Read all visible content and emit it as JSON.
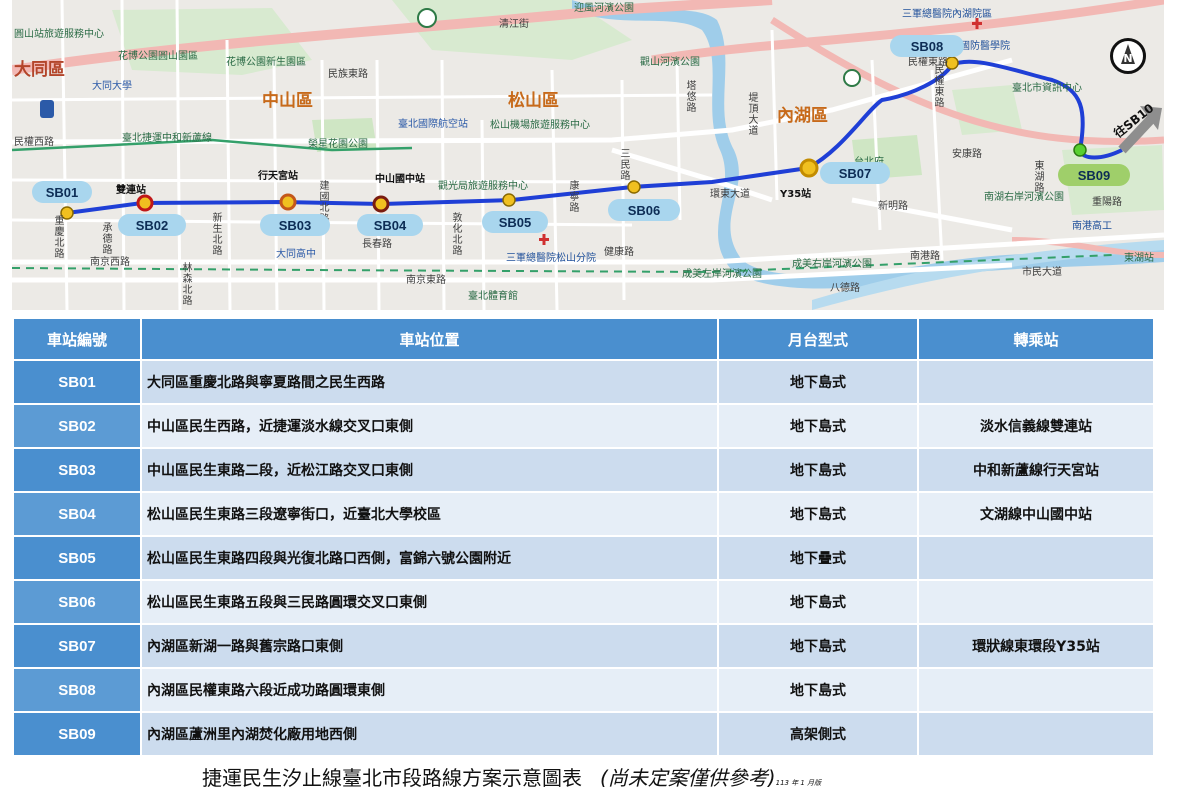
{
  "map": {
    "districts": [
      "大同區",
      "中山區",
      "松山區",
      "內湖區"
    ],
    "roads": [
      "民權東路",
      "民族東路",
      "民權西路",
      "南京西路",
      "南京東路",
      "新明路",
      "南港路",
      "市民大道",
      "安康路",
      "重慶北路",
      "承德路",
      "林森北路",
      "新生北路",
      "建國北路",
      "敦化北路",
      "塔悠路",
      "三民路",
      "環東大道",
      "長春路",
      "東湖路",
      "重陽路",
      "康寧路",
      "健康路",
      "清江街",
      "堤頂大道",
      "成美左岸河濱公園",
      "成美右岸河濱公園",
      "南湖右岸河濱公園",
      "觀山河濱公園",
      "迎風河濱公園"
    ],
    "pois": [
      "圓山站旅遊服務中心",
      "花博公園圓山園區",
      "花博公園新生園區",
      "大同大學",
      "臺北捷運中和新蘆線",
      "榮星花園公園",
      "臺北國際航空站",
      "松山機場旅遊服務中心",
      "觀光局旅遊服務中心",
      "三軍總醫院松山分院",
      "三軍總醫院內湖院區",
      "國防醫學院",
      "臺北市資訊中心",
      "臺北體育館",
      "南港高工",
      "大同高中",
      "台北府",
      "民權東路",
      "東湖站",
      "八德路"
    ],
    "station_labels": [
      "SB01",
      "SB02",
      "SB03",
      "SB04",
      "SB05",
      "SB06",
      "SB07",
      "SB08",
      "SB09"
    ],
    "transfer_labels": [
      "雙連站",
      "行天宮站",
      "中山國中站",
      "Y35站"
    ],
    "extension_label": "往SB10",
    "compass_label": "N",
    "colors": {
      "route": "#1f3fd6",
      "station_pill": "#a9d6ee",
      "terminal_pill": "#9fcf6a",
      "highway": "#f2b8b4",
      "river": "#9fcdea",
      "park": "#cfe6c4"
    }
  },
  "table": {
    "headers": [
      "車站編號",
      "車站位置",
      "月台型式",
      "轉乘站"
    ],
    "rows": [
      {
        "code": "SB01",
        "location": "大同區重慶北路與寧夏路間之民生西路",
        "platform": "地下島式",
        "transfer": ""
      },
      {
        "code": "SB02",
        "location": "中山區民生西路，近捷運淡水線交叉口東側",
        "platform": "地下島式",
        "transfer": "淡水信義線雙連站"
      },
      {
        "code": "SB03",
        "location": "中山區民生東路二段，近松江路交叉口東側",
        "platform": "地下島式",
        "transfer": "中和新蘆線行天宮站"
      },
      {
        "code": "SB04",
        "location": "松山區民生東路三段遼寧街口，近臺北大學校區",
        "platform": "地下島式",
        "transfer": "文湖線中山國中站"
      },
      {
        "code": "SB05",
        "location": "松山區民生東路四段與光復北路口西側，富錦六號公園附近",
        "platform": "地下疊式",
        "transfer": ""
      },
      {
        "code": "SB06",
        "location": "松山區民生東路五段與三民路圓環交叉口東側",
        "platform": "地下島式",
        "transfer": ""
      },
      {
        "code": "SB07",
        "location": "內湖區新湖一路與舊宗路口東側",
        "platform": "地下島式",
        "transfer": "環狀線東環段Y35站"
      },
      {
        "code": "SB08",
        "location": "內湖區民權東路六段近成功路圓環東側",
        "platform": "地下島式",
        "transfer": ""
      },
      {
        "code": "SB09",
        "location": "內湖區蘆洲里內湖焚化廠用地西側",
        "platform": "高架側式",
        "transfer": ""
      }
    ]
  },
  "caption": {
    "main": "捷運民生汐止線臺北市段路線方案示意圖表",
    "note": "(尚未定案僅供參考)",
    "date": "113 年 1 月版"
  }
}
